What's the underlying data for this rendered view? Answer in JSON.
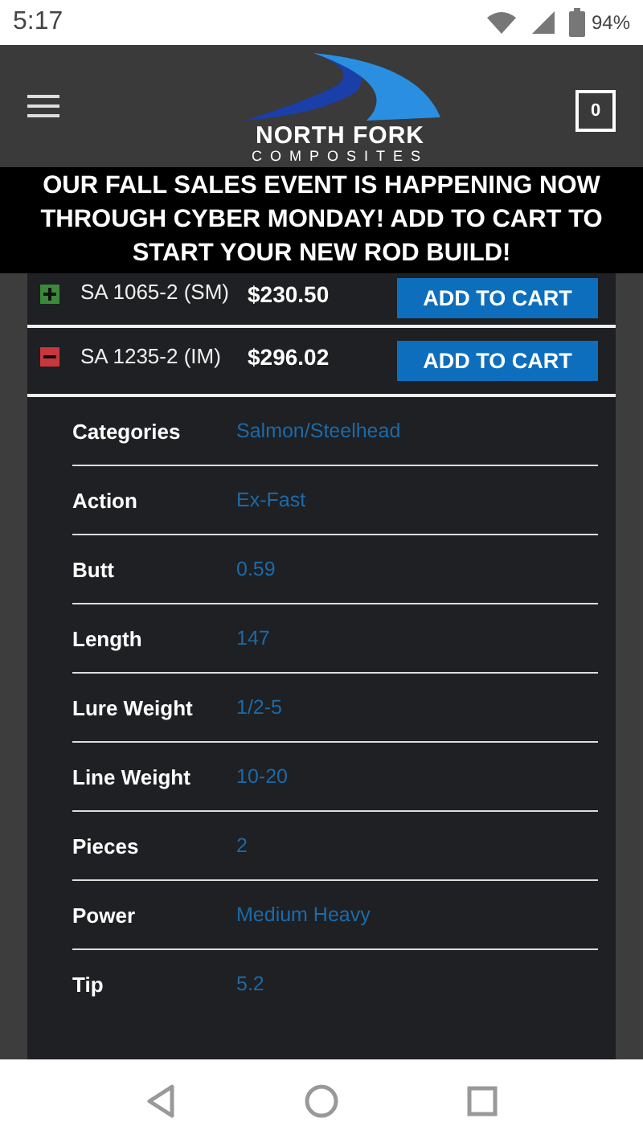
{
  "status_bar": {
    "time": "5:17",
    "battery": "94%"
  },
  "header": {
    "brand": "NORTH FORK",
    "brand_sub": "COMPOSITES",
    "cart_count": "0"
  },
  "banner": "OUR FALL SALES EVENT IS HAPPENING NOW THROUGH CYBER MONDAY! ADD TO CART TO START YOUR NEW ROD BUILD!",
  "products": [
    {
      "name": "SA 1065-2 (SM)",
      "price": "$230.50",
      "button": "ADD TO CART",
      "expanded": false
    },
    {
      "name": "SA 1235-2 (IM)",
      "price": "$296.02",
      "button": "ADD TO CART",
      "expanded": true
    }
  ],
  "details": [
    {
      "label": "Categories",
      "value": "Salmon/Steelhead"
    },
    {
      "label": "Action",
      "value": "Ex-Fast"
    },
    {
      "label": "Butt",
      "value": "0.59"
    },
    {
      "label": "Length",
      "value": "147"
    },
    {
      "label": "Lure Weight",
      "value": "1/2-5"
    },
    {
      "label": "Line Weight",
      "value": "10-20"
    },
    {
      "label": "Pieces",
      "value": "2"
    },
    {
      "label": "Power",
      "value": "Medium Heavy"
    },
    {
      "label": "Tip",
      "value": "5.2"
    }
  ]
}
